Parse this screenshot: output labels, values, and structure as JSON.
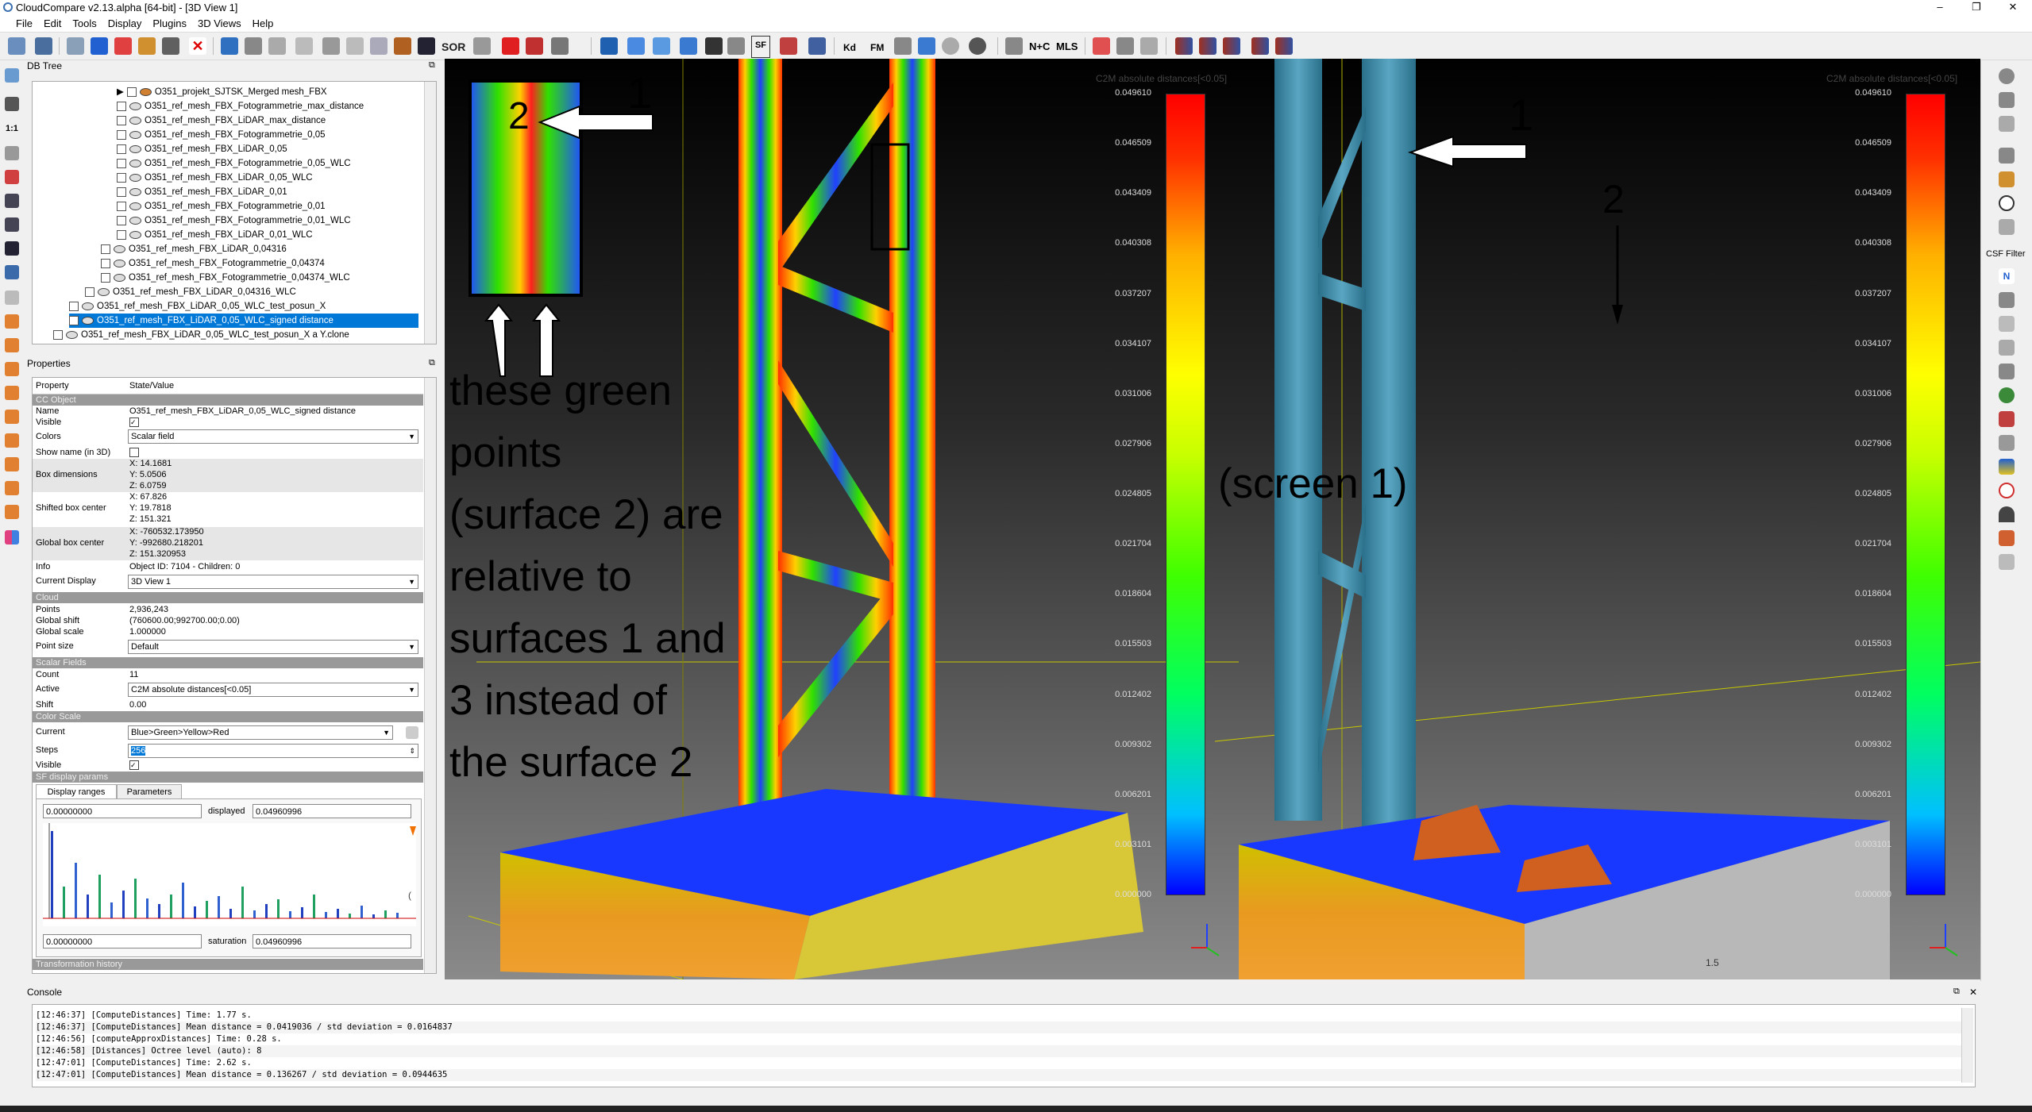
{
  "window": {
    "title": "CloudCompare v2.13.alpha [64-bit] - [3D View 1]",
    "controls": [
      "–",
      "❐",
      "✕"
    ]
  },
  "menu": [
    "File",
    "Edit",
    "Tools",
    "Display",
    "Plugins",
    "3D Views",
    "Help"
  ],
  "toolbar": {
    "sor_label": "SOR",
    "sf_label": "SF",
    "kd_label": "Kd",
    "fm_label": "FM",
    "nc_label": "N+C",
    "mls_label": "MLS"
  },
  "left_icons": {
    "scale_label": "1:1"
  },
  "right_icons": {
    "csf_label": "CSF Filter"
  },
  "dbtree": {
    "header": "DB Tree",
    "rows": [
      "O351_projekt_SJTSK_Merged mesh_FBX",
      "O351_ref_mesh_FBX_Fotogrammetrie_max_distance",
      "O351_ref_mesh_FBX_LiDAR_max_distance",
      "O351_ref_mesh_FBX_Fotogrammetrie_0,05",
      "O351_ref_mesh_FBX_LiDAR_0,05",
      "O351_ref_mesh_FBX_Fotogrammetrie_0,05_WLC",
      "O351_ref_mesh_FBX_LiDAR_0,05_WLC",
      "O351_ref_mesh_FBX_LiDAR_0,01",
      "O351_ref_mesh_FBX_Fotogrammetrie_0,01",
      "O351_ref_mesh_FBX_Fotogrammetrie_0,01_WLC",
      "O351_ref_mesh_FBX_LiDAR_0,01_WLC",
      "O351_ref_mesh_FBX_LiDAR_0,04316",
      "O351_ref_mesh_FBX_Fotogrammetrie_0,04374",
      "O351_ref_mesh_FBX_Fotogrammetrie_0,04374_WLC",
      "O351_ref_mesh_FBX_LiDAR_0,04316_WLC",
      "O351_ref_mesh_FBX_LiDAR_0,05_WLC_test_posun_X",
      "O351_ref_mesh_FBX_LiDAR_0,05_WLC_signed distance",
      "O351_ref_mesh_FBX_LiDAR_0,05_WLC_test_posun_X a Y.clone"
    ]
  },
  "properties": {
    "header": "Properties",
    "col_property": "Property",
    "col_value": "State/Value",
    "sections": {
      "cc_object": "CC Object",
      "cloud": "Cloud",
      "scalar_fields": "Scalar Fields",
      "color_scale": "Color Scale",
      "sf_display": "SF display params",
      "transformation": "Transformation history"
    },
    "rows": {
      "name": [
        "Name",
        "O351_ref_mesh_FBX_LiDAR_0,05_WLC_signed distance"
      ],
      "visible": [
        "Visible",
        ""
      ],
      "colors": [
        "Colors",
        "Scalar field"
      ],
      "show_name": [
        "Show name (in 3D)",
        ""
      ],
      "box_dims": [
        "Box dimensions",
        "X: 14.1681",
        "Y: 5.0506",
        "Z: 6.0759"
      ],
      "shifted_center": [
        "Shifted box center",
        "X: 67.826",
        "Y: 19.7818",
        "Z: 151.321"
      ],
      "global_center": [
        "Global box center",
        "X: -760532.173950",
        "Y: -992680.218201",
        "Z: 151.320953"
      ],
      "info": [
        "Info",
        "Object ID: 7104 - Children: 0"
      ],
      "current_display": [
        "Current Display",
        "3D View 1"
      ],
      "points": [
        "Points",
        "2,936,243"
      ],
      "global_shift": [
        "Global shift",
        "(760600.00;992700.00;0.00)"
      ],
      "global_scale": [
        "Global scale",
        "1.000000"
      ],
      "point_size": [
        "Point size",
        "Default"
      ],
      "count": [
        "Count",
        "11"
      ],
      "active": [
        "Active",
        "C2M absolute distances[<0.05]"
      ],
      "shift": [
        "Shift",
        "0.00"
      ],
      "current": [
        "Current",
        "Blue>Green>Yellow>Red"
      ],
      "steps": [
        "Steps",
        "256"
      ],
      "visible2": [
        "Visible",
        ""
      ]
    },
    "tabs": [
      "Display ranges",
      "Parameters"
    ],
    "range": {
      "min_top": "0.00000000",
      "displayed_label": "displayed",
      "displayed": "0.04960996",
      "min_bottom": "0.00000000",
      "saturation_label": "saturation",
      "saturation": "0.04960996"
    }
  },
  "view": {
    "colorbar_title": "C2M absolute distances[<0.05]",
    "ticks": [
      "0.049610",
      "0.046509",
      "0.043409",
      "0.040308",
      "0.037207",
      "0.034107",
      "0.031006",
      "0.027906",
      "0.024805",
      "0.021704",
      "0.018604",
      "0.015503",
      "0.012402",
      "0.009302",
      "0.006201",
      "0.003101",
      "0.000000"
    ],
    "annotation_text": [
      "these green",
      "points",
      "(surface 2) are",
      "relative to",
      "surfaces 1 and",
      "3 instead of",
      "the surface 2"
    ],
    "screen_label": "(screen 1)",
    "marker_1": "1",
    "marker_2": "2",
    "scale_value": "1.5"
  },
  "console": {
    "header": "Console",
    "lines": [
      "[12:46:37] [ComputeDistances] Time: 1.77 s.",
      "[12:46:37] [ComputeDistances] Mean distance = 0.0419036 / std deviation = 0.0164837",
      "[12:46:56] [computeApproxDistances] Time: 0.28 s.",
      "[12:46:58] [Distances] Octree level (auto): 8",
      "[12:47:01] [ComputeDistances] Time: 2.62 s.",
      "[12:47:01] [ComputeDistances] Mean distance = 0.136267 / std deviation = 0.0944635"
    ]
  }
}
